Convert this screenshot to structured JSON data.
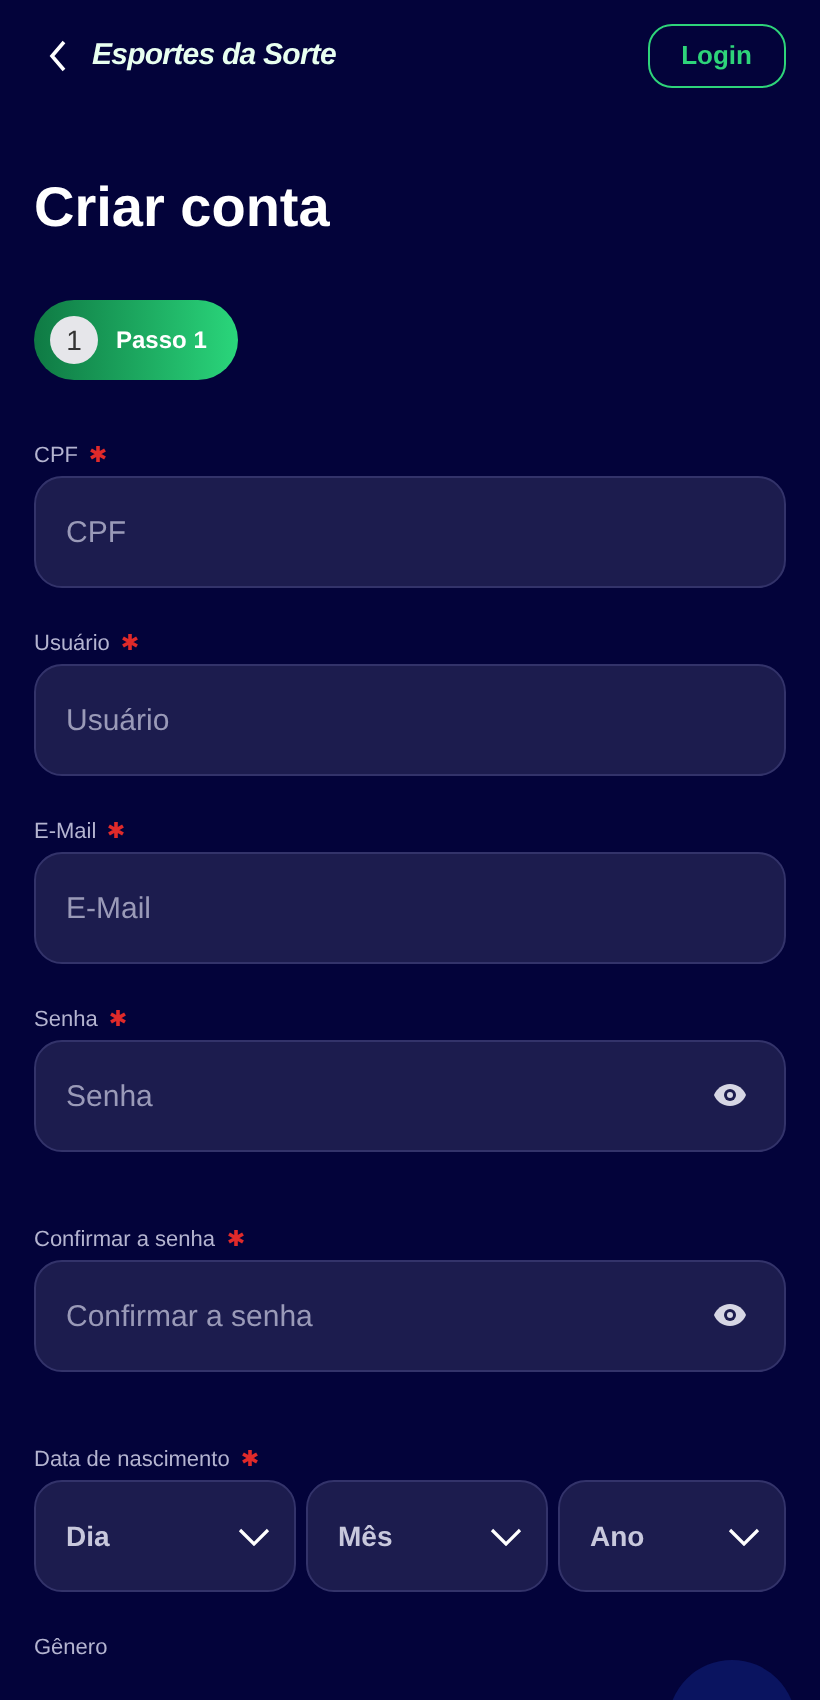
{
  "header": {
    "logo_text": "Esportes da Sorte",
    "login_button": "Login"
  },
  "title": "Criar conta",
  "steps": [
    {
      "number": "1",
      "label": "Passo 1",
      "selected": true
    }
  ],
  "fields": [
    {
      "kind": "text",
      "label": "CPF",
      "required": true,
      "placeholder": "CPF"
    },
    {
      "kind": "text",
      "label": "Usuário",
      "required": true,
      "placeholder": "Usuário"
    },
    {
      "kind": "text",
      "label": "E-Mail",
      "required": true,
      "placeholder": "E-Mail"
    },
    {
      "kind": "password",
      "label": "Senha",
      "required": true,
      "placeholder": "Senha"
    },
    {
      "kind": "password",
      "label": "Confirmar a senha",
      "required": true,
      "placeholder": "Confirmar a senha"
    },
    {
      "kind": "date",
      "label": "Data de nascimento",
      "required": true,
      "selects": [
        "Dia",
        "Mês",
        "Ano"
      ]
    },
    {
      "kind": "label_only",
      "label": "Gênero",
      "required": false
    }
  ]
}
